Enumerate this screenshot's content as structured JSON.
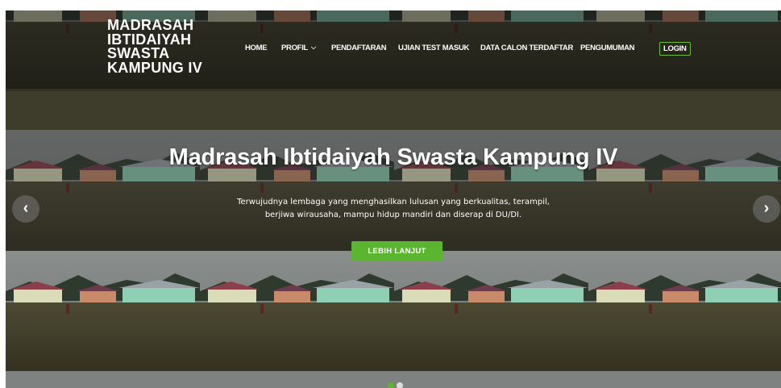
{
  "site": {
    "brand_lines": [
      "MADRASAH",
      "IBTIDAIYAH",
      "SWASTA",
      "KAMPUNG IV"
    ]
  },
  "nav": {
    "items": [
      {
        "label": "HOME"
      },
      {
        "label": "PROFIL"
      },
      {
        "label": "PENDAFTARAN"
      },
      {
        "label": "UJIAN TEST MASUK"
      },
      {
        "label": "DATA CALON TERDAFTAR"
      },
      {
        "label": "PENGUMUMAN"
      }
    ],
    "login_label": "LOGIN",
    "dropdown_icon": "chevron-down-icon"
  },
  "hero": {
    "title": "Madrasah Ibtidaiyah Swasta Kampung IV",
    "subtitle": "Terwujudnya lembaga yang menghasilkan lulusan yang berkualitas, terampil, berjiwa wirausaha, mampu hidup mandiri dan diserap di DU/DI.",
    "cta_label": "LEBIH LANJUT",
    "prev_icon": "chevron-left-icon",
    "next_icon": "chevron-right-icon",
    "slides_total": 2,
    "active_slide": 1
  },
  "colors": {
    "accent": "#5cb531",
    "login_border": "#6abf3a",
    "header_overlay": "#121212",
    "text": "#ffffff"
  }
}
